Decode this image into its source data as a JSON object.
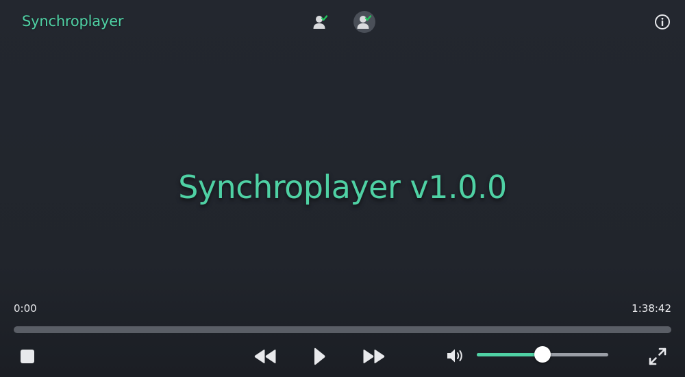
{
  "app": {
    "brand": "Synchroplayer",
    "splash_title": "Synchroplayer v1.0.0"
  },
  "header": {
    "users": [
      {
        "icon": "user-check-icon",
        "active": false
      },
      {
        "icon": "user-check-icon",
        "active": true
      }
    ],
    "info_icon": "info-icon"
  },
  "player": {
    "current_time": "0:00",
    "duration": "1:38:42",
    "progress": 0.0,
    "volume": 0.5,
    "controls": {
      "stop_icon": "stop-icon",
      "rewind_icon": "rewind-icon",
      "play_icon": "play-icon",
      "forward_icon": "fast-forward-icon",
      "volume_icon": "volume-icon",
      "fullscreen_icon": "fullscreen-icon"
    }
  },
  "colors": {
    "accent": "#4fd1a4",
    "background": "#22262d",
    "check_green": "#22c55e"
  }
}
